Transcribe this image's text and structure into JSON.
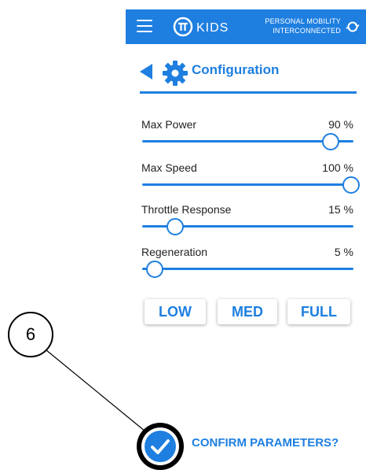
{
  "appbar": {
    "brand": "KIDS",
    "tagline_line1": "PERSONAL MOBILITY",
    "tagline_line2": "INTERCONNECTED",
    "color": "#1e7fe0"
  },
  "header": {
    "title": "Configuration",
    "icons": [
      "back-arrow-icon",
      "gear-icon"
    ]
  },
  "settings": [
    {
      "label": "Max Power",
      "value_text": "90 %",
      "level": 0.9
    },
    {
      "label": "Max Speed",
      "value_text": "100 %",
      "level": 1.0
    },
    {
      "label": "Throttle Response",
      "value_text": "15 %",
      "level": 0.15
    },
    {
      "label": "Regeneration",
      "value_text": "5 %",
      "level": 0.05
    }
  ],
  "presets": [
    "LOW",
    "MED",
    "FULL"
  ],
  "callout": {
    "number": "6"
  },
  "confirm": {
    "label": "CONFIRM PARAMETERS?",
    "icon": "checkmark-icon"
  }
}
